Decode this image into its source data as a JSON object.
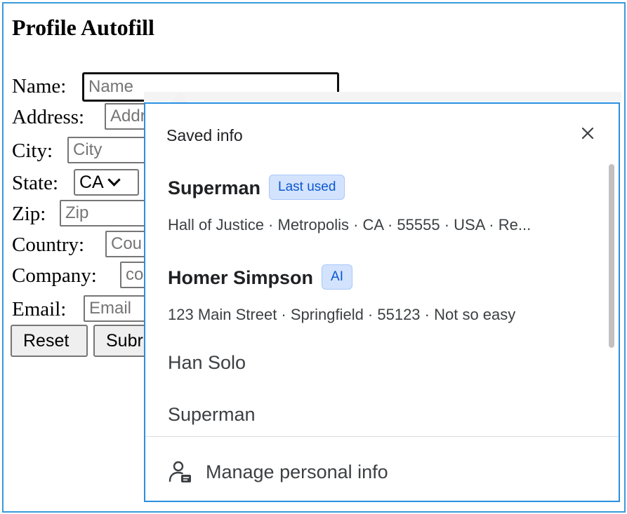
{
  "page": {
    "title": "Profile Autofill"
  },
  "form": {
    "name": {
      "label": "Name:",
      "placeholder": "Name"
    },
    "address": {
      "label": "Address:",
      "placeholder": "Addr"
    },
    "city": {
      "label": "City:",
      "placeholder": "City"
    },
    "state": {
      "label": "State:",
      "value": "CA"
    },
    "zip": {
      "label": "Zip:",
      "placeholder": "Zip"
    },
    "country": {
      "label": "Country:",
      "placeholder": "Cou"
    },
    "company": {
      "label": "Company:",
      "placeholder": "co"
    },
    "email": {
      "label": "Email:",
      "placeholder": "Email"
    },
    "reset_label": "Reset",
    "submit_label": "Subr"
  },
  "popup": {
    "header": "Saved info",
    "close_icon": "close-icon",
    "entries": [
      {
        "title": "Superman",
        "badge": "Last used",
        "subtitle": "Hall of Justice · Metropolis · CA · 55555 · USA · Re..."
      },
      {
        "title": "Homer Simpson",
        "badge": "AI",
        "subtitle": "123 Main Street · Springfield · 55123 · Not so easy"
      },
      {
        "title": "Han Solo"
      },
      {
        "title": "Superman"
      }
    ],
    "manage_label": "Manage personal info",
    "manage_icon": "person-card-icon",
    "colors": {
      "border": "#2a8fe0",
      "badge_bg": "#d3e3fd",
      "badge_text": "#0b57d0"
    }
  }
}
